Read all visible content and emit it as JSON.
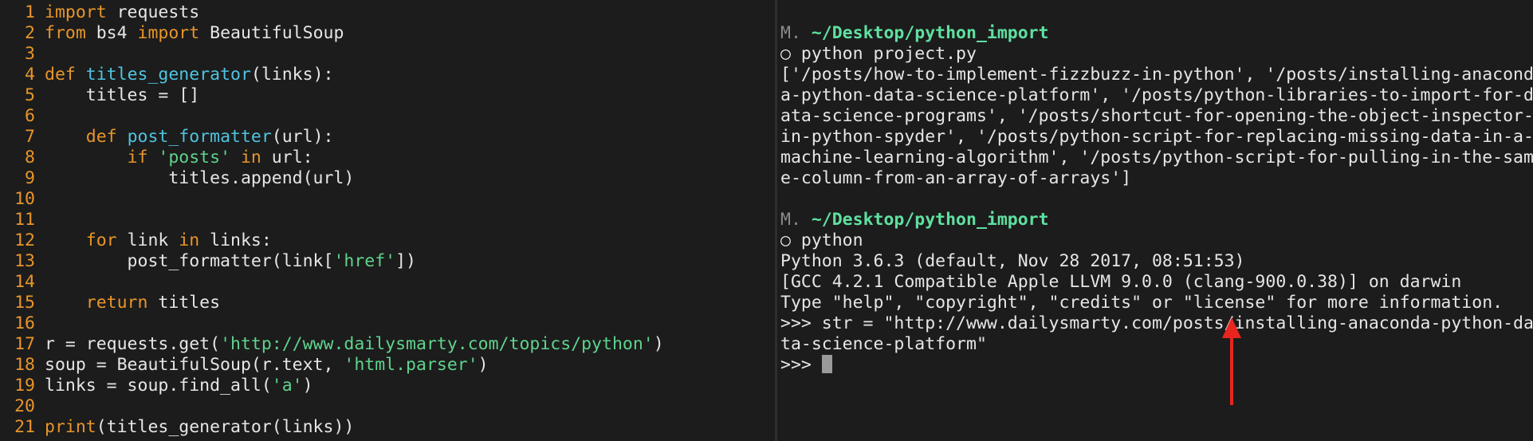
{
  "editor": {
    "lines": [
      {
        "n": "1",
        "tokens": [
          [
            "kw",
            "import"
          ],
          [
            "code",
            " requests"
          ]
        ]
      },
      {
        "n": "2",
        "tokens": [
          [
            "kw",
            "from"
          ],
          [
            "code",
            " bs4 "
          ],
          [
            "kw",
            "import"
          ],
          [
            "code",
            " BeautifulSoup"
          ]
        ]
      },
      {
        "n": "3",
        "tokens": []
      },
      {
        "n": "4",
        "tokens": [
          [
            "kw",
            "def"
          ],
          [
            "code",
            " "
          ],
          [
            "fn",
            "titles_generator"
          ],
          [
            "code",
            "(links):"
          ]
        ]
      },
      {
        "n": "5",
        "tokens": [
          [
            "code",
            "    titles = []"
          ]
        ]
      },
      {
        "n": "6",
        "tokens": []
      },
      {
        "n": "7",
        "tokens": [
          [
            "code",
            "    "
          ],
          [
            "kw",
            "def"
          ],
          [
            "code",
            " "
          ],
          [
            "fn",
            "post_formatter"
          ],
          [
            "code",
            "(url):"
          ]
        ]
      },
      {
        "n": "8",
        "tokens": [
          [
            "code",
            "        "
          ],
          [
            "kw",
            "if"
          ],
          [
            "code",
            " "
          ],
          [
            "str",
            "'posts'"
          ],
          [
            "code",
            " "
          ],
          [
            "kw",
            "in"
          ],
          [
            "code",
            " url:"
          ]
        ]
      },
      {
        "n": "9",
        "tokens": [
          [
            "code",
            "            titles.append(url)"
          ]
        ]
      },
      {
        "n": "10",
        "tokens": []
      },
      {
        "n": "11",
        "tokens": []
      },
      {
        "n": "12",
        "tokens": [
          [
            "code",
            "    "
          ],
          [
            "kw",
            "for"
          ],
          [
            "code",
            " link "
          ],
          [
            "kw",
            "in"
          ],
          [
            "code",
            " links:"
          ]
        ]
      },
      {
        "n": "13",
        "tokens": [
          [
            "code",
            "        post_formatter(link["
          ],
          [
            "str",
            "'href'"
          ],
          [
            "code",
            "])"
          ]
        ]
      },
      {
        "n": "14",
        "tokens": []
      },
      {
        "n": "15",
        "tokens": [
          [
            "code",
            "    "
          ],
          [
            "kw",
            "return"
          ],
          [
            "code",
            " titles"
          ]
        ]
      },
      {
        "n": "16",
        "tokens": []
      },
      {
        "n": "17",
        "tokens": [
          [
            "code",
            "r = requests.get("
          ],
          [
            "str",
            "'http://www.dailysmarty.com/topics/python'"
          ],
          [
            "code",
            ")"
          ]
        ]
      },
      {
        "n": "18",
        "tokens": [
          [
            "code",
            "soup = BeautifulSoup(r.text, "
          ],
          [
            "str",
            "'html.parser'"
          ],
          [
            "code",
            ")"
          ]
        ]
      },
      {
        "n": "19",
        "tokens": [
          [
            "code",
            "links = soup.find_all("
          ],
          [
            "str",
            "'a'"
          ],
          [
            "code",
            ")"
          ]
        ]
      },
      {
        "n": "20",
        "tokens": []
      },
      {
        "n": "21",
        "tokens": [
          [
            "kw",
            "print"
          ],
          [
            "code",
            "(titles_generator(links))"
          ]
        ]
      }
    ]
  },
  "terminal": {
    "prompt_prefix": "M.",
    "prompt_path": "~/Desktop/python_import",
    "command_1": "○ python project.py",
    "output_1": [
      "['/posts/how-to-implement-fizzbuzz-in-python', '/posts/installing-anacond",
      "a-python-data-science-platform', '/posts/python-libraries-to-import-for-d",
      "ata-science-programs', '/posts/shortcut-for-opening-the-object-inspector-",
      "in-python-spyder', '/posts/python-script-for-replacing-missing-data-in-a-",
      "machine-learning-algorithm', '/posts/python-script-for-pulling-in-the-sam",
      "e-column-from-an-array-of-arrays']"
    ],
    "command_2": "○ python",
    "output_2": [
      "Python 3.6.3 (default, Nov 28 2017, 08:51:53)",
      "[GCC 4.2.1 Compatible Apple LLVM 9.0.0 (clang-900.0.38)] on darwin",
      "Type \"help\", \"copyright\", \"credits\" or \"license\" for more information.",
      ">>> str = \"http://www.dailysmarty.com/posts/installing-anaconda-python-da",
      "ta-science-platform\""
    ],
    "repl_prompt": ">>> ",
    "annotation_color": "#e8251f"
  }
}
